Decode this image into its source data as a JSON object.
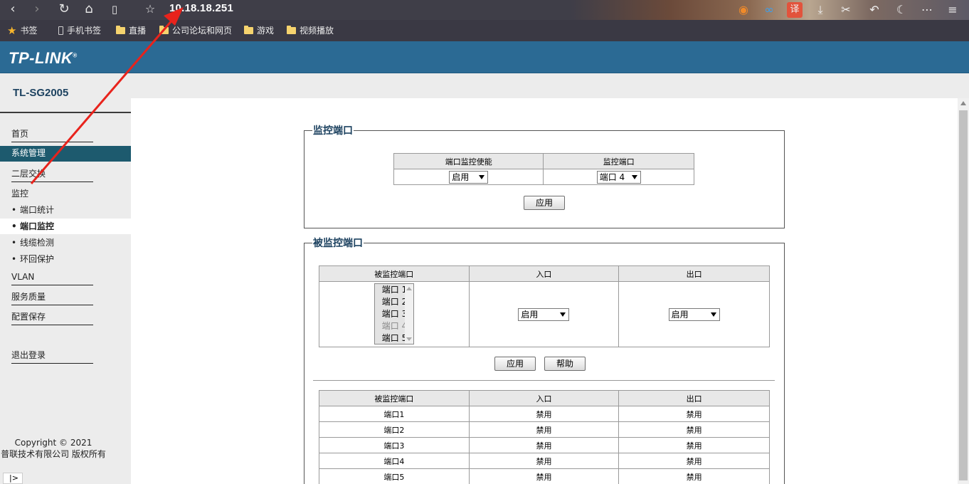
{
  "browser": {
    "url": "10.18.18.251",
    "bookmarks": [
      "书签",
      "手机书签",
      "直播",
      "公司论坛和网页",
      "游戏",
      "视频播放"
    ],
    "translate_label": "译"
  },
  "header": {
    "logo": "TP-LINK"
  },
  "sidebar": {
    "model": "TL-SG2005",
    "items": {
      "home": "首页",
      "system": "系统管理",
      "l2": "二层交换",
      "monitor": "监控",
      "port_stats": "端口统计",
      "port_mirror": "端口监控",
      "cable_test": "线缆检测",
      "loop_protect": "环回保护",
      "vlan": "VLAN",
      "qos": "服务质量",
      "save": "配置保存",
      "logout": "退出登录"
    },
    "copyright_line1": "Copyright © 2021",
    "copyright_line2": "普联技术有限公司 版权所有"
  },
  "monitor_port": {
    "legend": "监控端口",
    "col_enable": "端口监控使能",
    "col_port": "监控端口",
    "enable_value": "启用",
    "port_value": "端口 4",
    "apply": "应用"
  },
  "monitored_port": {
    "legend": "被监控端口",
    "col_port": "被监控端口",
    "col_ingress": "入口",
    "col_egress": "出口",
    "port_options": [
      "端口 1",
      "端口 2",
      "端口 3",
      "端口 4",
      "端口 5"
    ],
    "ingress_value": "启用",
    "egress_value": "启用",
    "apply": "应用",
    "help": "帮助",
    "table_rows": [
      {
        "port": "端口1",
        "ingress": "禁用",
        "egress": "禁用"
      },
      {
        "port": "端口2",
        "ingress": "禁用",
        "egress": "禁用"
      },
      {
        "port": "端口3",
        "ingress": "禁用",
        "egress": "禁用"
      },
      {
        "port": "端口4",
        "ingress": "禁用",
        "egress": "禁用"
      },
      {
        "port": "端口5",
        "ingress": "禁用",
        "egress": "禁用"
      }
    ]
  },
  "colors": {
    "header_blue": "#2b6a94",
    "sidebar_active": "#1d5a6e",
    "legend_text": "#1d4260",
    "annotation_arrow": "#e8231c"
  }
}
